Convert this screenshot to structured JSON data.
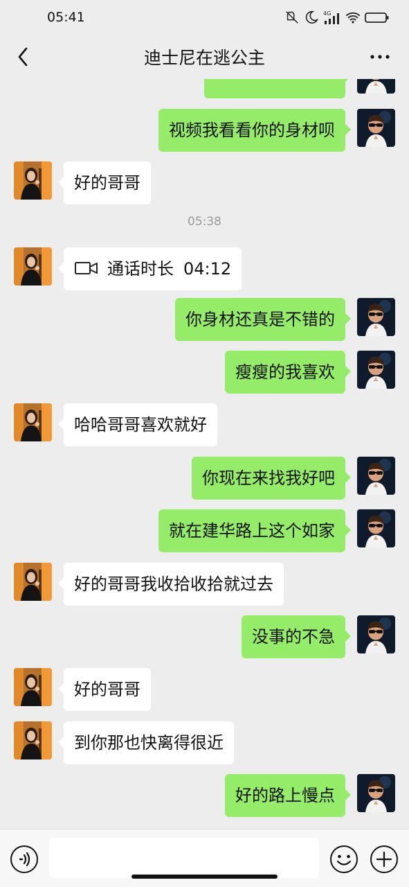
{
  "status_bar": {
    "time": "05:41",
    "icons": [
      "mute-icon",
      "moon-icon",
      "signal-4g-icon",
      "wifi-icon",
      "battery-icon"
    ],
    "signal_label": "4G"
  },
  "nav": {
    "title": "迪士尼在逃公主",
    "back_icon": "chevron-left-icon",
    "more_icon": "more-dots-icon"
  },
  "timestamp": "05:38",
  "messages": [
    {
      "side": "right",
      "text": ""
    },
    {
      "side": "right",
      "text": "视频我看看你的身材呗"
    },
    {
      "side": "left",
      "text": "好的哥哥"
    },
    {
      "side": "left",
      "type": "video-call",
      "label": "通话时长",
      "duration": "04:12"
    },
    {
      "side": "right",
      "text": "你身材还真是不错的"
    },
    {
      "side": "right",
      "text": "瘦瘦的我喜欢"
    },
    {
      "side": "left",
      "text": "哈哈哥哥喜欢就好"
    },
    {
      "side": "right",
      "text": "你现在来找我好吧"
    },
    {
      "side": "right",
      "text": "就在建华路上这个如家"
    },
    {
      "side": "left",
      "text": "好的哥哥我收拾收拾就过去"
    },
    {
      "side": "right",
      "text": "没事的不急"
    },
    {
      "side": "left",
      "text": "好的哥哥"
    },
    {
      "side": "left",
      "text": "到你那也快离得很近"
    },
    {
      "side": "right",
      "text": "好的路上慢点"
    }
  ],
  "bottom_bar": {
    "voice_icon": "voice-icon",
    "emoji_icon": "emoji-icon",
    "plus_icon": "plus-icon",
    "input_value": ""
  },
  "colors": {
    "background": "#ededed",
    "bubble_self": "#95ec69",
    "bubble_other": "#ffffff",
    "timestamp": "#9a9a9a"
  }
}
